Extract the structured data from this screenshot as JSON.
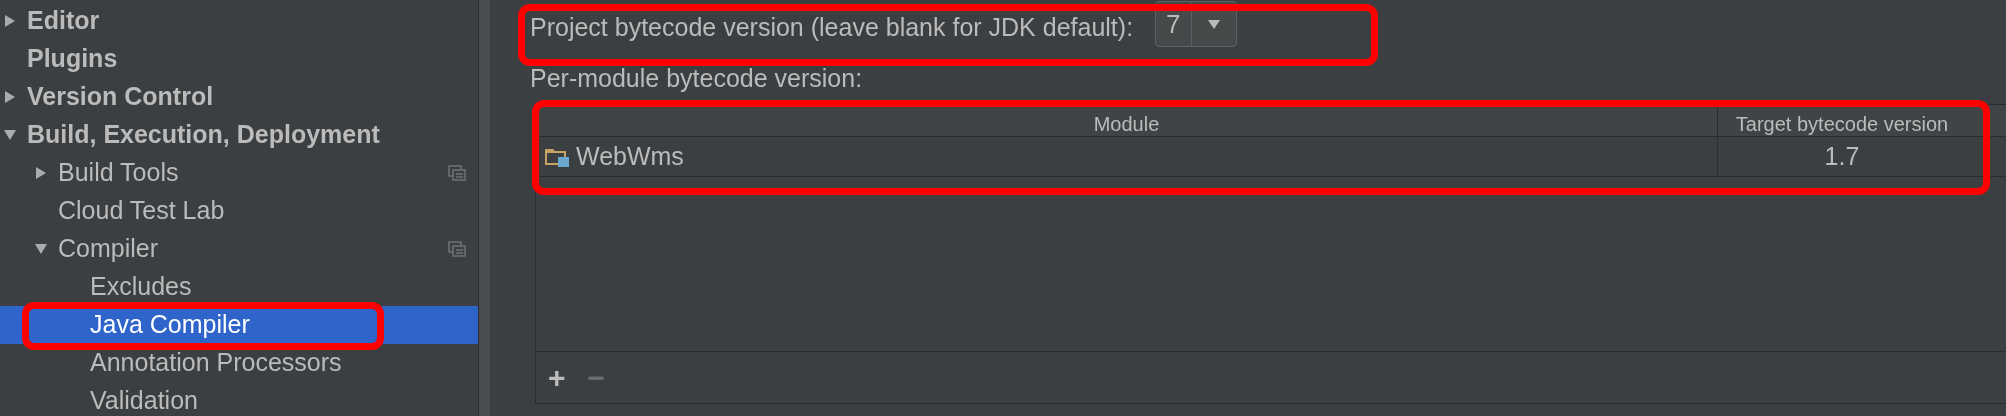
{
  "sidebar": {
    "items": [
      {
        "label": "Editor",
        "expanded": false
      },
      {
        "label": "Plugins"
      },
      {
        "label": "Version Control",
        "expanded": false
      },
      {
        "label": "Build, Execution, Deployment",
        "expanded": true,
        "children": [
          {
            "label": "Build Tools",
            "expanded": false,
            "project_scoped": true
          },
          {
            "label": "Cloud Test Lab"
          },
          {
            "label": "Compiler",
            "expanded": true,
            "project_scoped": true,
            "children": [
              {
                "label": "Excludes",
                "selected": false
              },
              {
                "label": "Java Compiler",
                "selected": true,
                "highlighted": true
              },
              {
                "label": "Annotation Processors",
                "selected": false
              },
              {
                "label": "Validation",
                "selected": false
              }
            ]
          }
        ]
      }
    ]
  },
  "project_bytecode": {
    "label": "Project bytecode version (leave blank for JDK default):",
    "value": "7",
    "highlighted": true
  },
  "per_module": {
    "label": "Per-module bytecode version:",
    "table": {
      "highlighted": true,
      "columns": [
        "Module",
        "Target bytecode version"
      ],
      "rows": [
        {
          "module": "WebWms",
          "target": "1.7"
        }
      ]
    },
    "toolbar": [
      {
        "label": "+",
        "disabled": false
      },
      {
        "label": "−",
        "disabled": true
      }
    ]
  }
}
